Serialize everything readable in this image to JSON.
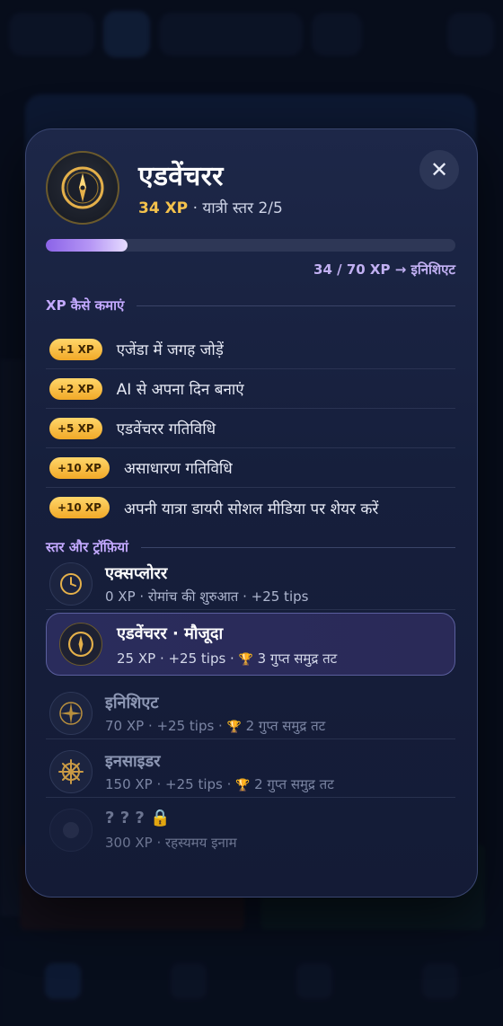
{
  "modal": {
    "title": "एडवेंचरर",
    "xp": "34 XP",
    "level_text": "· यात्री स्तर 2/5",
    "close_label": "✕",
    "progress": {
      "fraction": 0.2,
      "text": "34 / 70 XP → इनिशिएट"
    }
  },
  "earn": {
    "title": "XP कैसे कमाएं",
    "items": [
      {
        "chip": "+1 XP",
        "label": "एजेंडा में जगह जोड़ें"
      },
      {
        "chip": "+2 XP",
        "label": "AI से अपना दिन बनाएं"
      },
      {
        "chip": "+5 XP",
        "label": "एडवेंचरर गतिविधि"
      },
      {
        "chip": "+10 XP",
        "label": "असाधारण गतिविधि"
      },
      {
        "chip": "+10 XP",
        "label": "अपनी यात्रा डायरी सोशल मीडिया पर शेयर करें"
      }
    ]
  },
  "levels": {
    "title": "स्तर और ट्रॉफ़ियां",
    "items": [
      {
        "name": "एक्सप्लोरर",
        "meta": "0 XP · रोमांच की शुरुआत · +25 tips",
        "trophy": "",
        "trophy_text": "",
        "icon": "clock-icon"
      },
      {
        "name": "एडवेंचरर · मौजूदा",
        "meta": "25 XP · +25 tips ·",
        "trophy": "🏆",
        "trophy_text": "3 गुप्त समुद्र तट",
        "icon": "compass-icon"
      },
      {
        "name": "इनिशिएट",
        "meta": "70 XP · +25 tips ·",
        "trophy": "🏆",
        "trophy_text": "2 गुप्त समुद्र तट",
        "icon": "compass-rose-icon"
      },
      {
        "name": "इनसाइडर",
        "meta": "150 XP · +25 tips ·",
        "trophy": "🏆",
        "trophy_text": "2 गुप्त समुद्र तट",
        "icon": "ship-wheel-icon"
      },
      {
        "name": "? ? ? 🔒",
        "meta": "300 XP · रहस्यमय इनाम",
        "trophy": "",
        "trophy_text": "",
        "icon": "mystery-icon"
      }
    ]
  },
  "colors": {
    "accent": "#8b63e8",
    "xp_gold": "#f4c24c",
    "bg": "#0a1222"
  }
}
